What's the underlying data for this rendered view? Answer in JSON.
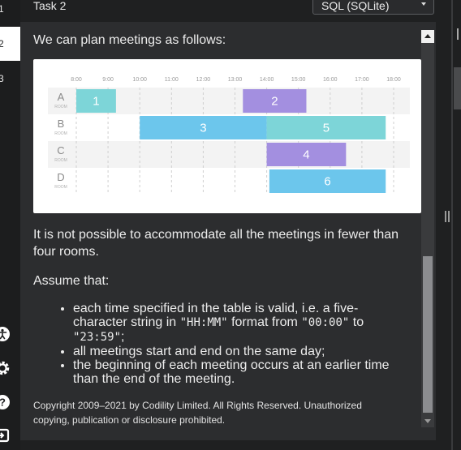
{
  "task_list": {
    "items": [
      "1",
      "2",
      "3"
    ],
    "active_index": 1
  },
  "header": {
    "task_title": "Task 2",
    "language": "SQL (SQLite)"
  },
  "description": {
    "intro": "We can plan meetings as follows:",
    "schedule": {
      "times": [
        "8:00",
        "9:00",
        "10:00",
        "11:00",
        "12:00",
        "13:00",
        "14:00",
        "15:00",
        "16:00",
        "17:00",
        "18:00"
      ],
      "rooms": [
        {
          "letter": "A",
          "sub": "ROOM"
        },
        {
          "letter": "B",
          "sub": "ROOM"
        },
        {
          "letter": "C",
          "sub": "ROOM"
        },
        {
          "letter": "D",
          "sub": "ROOM"
        }
      ],
      "meetings": [
        {
          "label": "1",
          "room": 0,
          "start": "08:00",
          "end": "09:15",
          "color": "#7dd5d8"
        },
        {
          "label": "2",
          "room": 0,
          "start": "13:15",
          "end": "15:15",
          "color": "#a38fe0"
        },
        {
          "label": "3",
          "room": 1,
          "start": "10:00",
          "end": "14:00",
          "color": "#6cc6ec"
        },
        {
          "label": "5",
          "room": 1,
          "start": "14:00",
          "end": "17:45",
          "color": "#7dd5d8"
        },
        {
          "label": "4",
          "room": 2,
          "start": "14:00",
          "end": "16:30",
          "color": "#a38fe0"
        },
        {
          "label": "6",
          "room": 3,
          "start": "14:05",
          "end": "17:45",
          "color": "#6cc6ec"
        }
      ]
    },
    "not_possible": "It is not possible to accommodate all the meetings in fewer than four rooms.",
    "assume_heading": "Assume that:",
    "assumptions": {
      "a1_pre": "each time specified in the table is valid, i.e. a five-character string in ",
      "a1_fmt": "\"HH:MM\"",
      "a1_mid": " format from ",
      "a1_from": "\"00:00\"",
      "a1_to_word": " to ",
      "a1_to": "\"23:59\"",
      "a1_end": ";",
      "a2": "all meetings start and end on the same day;",
      "a3": "the beginning of each meeting occurs at an earlier time than the end of the meeting."
    },
    "copyright": "Copyright 2009–2021 by Codility Limited. All Rights Reserved. Unauthorized copying, publication or disclosure prohibited."
  },
  "icons": [
    "accessibility-icon",
    "settings-icon",
    "help-icon",
    "exit-icon"
  ]
}
